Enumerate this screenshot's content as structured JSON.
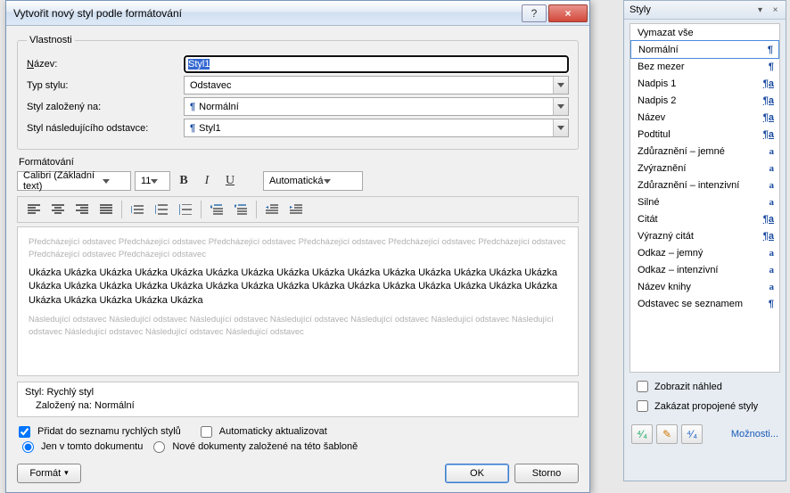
{
  "dialog": {
    "title": "Vytvořit nový styl podle formátování",
    "help_icon": "?",
    "close_icon": "×",
    "properties": {
      "legend": "Vlastnosti",
      "name_label": "Název:",
      "name_value": "Styl1",
      "type_label": "Typ stylu:",
      "type_value": "Odstavec",
      "based_label": "Styl založený na:",
      "based_value": "Normální",
      "following_label": "Styl následujícího odstavce:",
      "following_value": "Styl1"
    },
    "formatting_label": "Formátování",
    "font_name": "Calibri (Základní text)",
    "font_size": "11",
    "bold": "B",
    "italic": "I",
    "underline": "U",
    "color_combo": "Automatická",
    "preview": {
      "prev_para": "Předcházející odstavec Předcházející odstavec Předcházející odstavec Předcházející odstavec Předcházející odstavec Předcházející odstavec Předcházející odstavec Předcházející odstavec",
      "sample": "Ukázka Ukázka Ukázka Ukázka Ukázka Ukázka Ukázka Ukázka Ukázka Ukázka Ukázka Ukázka Ukázka Ukázka Ukázka Ukázka Ukázka Ukázka Ukázka Ukázka Ukázka Ukázka Ukázka Ukázka Ukázka Ukázka Ukázka Ukázka Ukázka Ukázka Ukázka Ukázka Ukázka Ukázka Ukázka",
      "next_para": "Následující odstavec Následující odstavec Následující odstavec Následující odstavec Následující odstavec Následující odstavec Následující odstavec Následující odstavec Následující odstavec Následující odstavec"
    },
    "info_line1": "Styl: Rychlý styl",
    "info_line2": "Založený na: Normální",
    "check_quick": "Přidat do seznamu rychlých stylů",
    "check_auto": "Automaticky aktualizovat",
    "radio_doc": "Jen v tomto dokumentu",
    "radio_template": "Nové dokumenty založené na této šabloně",
    "format_btn": "Formát",
    "ok_btn": "OK",
    "cancel_btn": "Storno"
  },
  "pane": {
    "title": "Styly",
    "items": [
      {
        "label": "Vymazat vše",
        "glyph": ""
      },
      {
        "label": "Normální",
        "glyph": "¶",
        "selected": true
      },
      {
        "label": "Bez mezer",
        "glyph": "¶"
      },
      {
        "label": "Nadpis 1",
        "glyph": "¶a"
      },
      {
        "label": "Nadpis 2",
        "glyph": "¶a"
      },
      {
        "label": "Název",
        "glyph": "¶a"
      },
      {
        "label": "Podtitul",
        "glyph": "¶a"
      },
      {
        "label": "Zdůraznění – jemné",
        "glyph": "a"
      },
      {
        "label": "Zvýraznění",
        "glyph": "a"
      },
      {
        "label": "Zdůraznění – intenzivní",
        "glyph": "a"
      },
      {
        "label": "Silné",
        "glyph": "a"
      },
      {
        "label": "Citát",
        "glyph": "¶a"
      },
      {
        "label": "Výrazný citát",
        "glyph": "¶a"
      },
      {
        "label": "Odkaz – jemný",
        "glyph": "a"
      },
      {
        "label": "Odkaz – intenzivní",
        "glyph": "a"
      },
      {
        "label": "Název knihy",
        "glyph": "a"
      },
      {
        "label": "Odstavec se seznamem",
        "glyph": "¶"
      }
    ],
    "chk_preview": "Zobrazit náhled",
    "chk_disable": "Zakázat propojené styly",
    "options_link": "Možnosti..."
  }
}
